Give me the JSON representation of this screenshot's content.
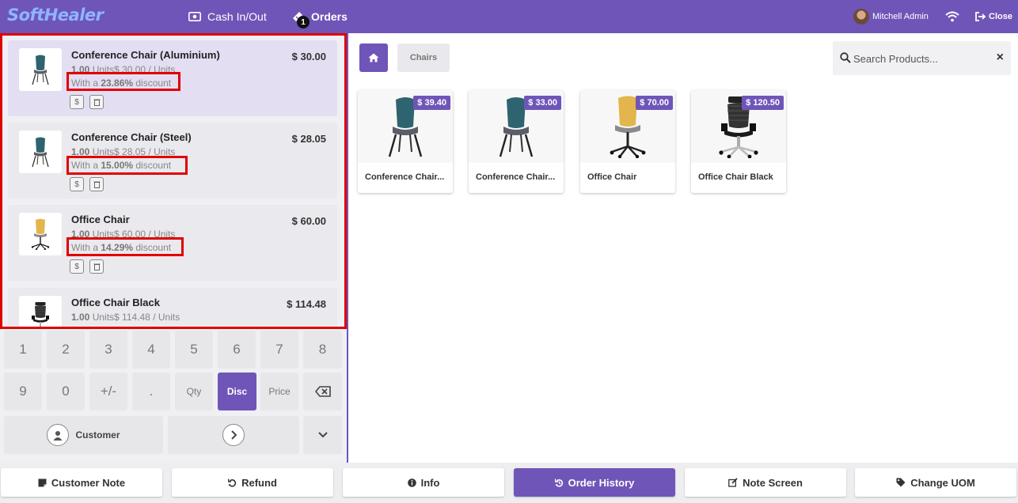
{
  "topbar": {
    "logo": "SoftHealer",
    "cash_label": "Cash In/Out",
    "orders_label": "Orders",
    "orders_badge": "1",
    "user_name": "Mitchell Admin",
    "close_label": "Close"
  },
  "orderlines": [
    {
      "name": "Conference Chair (Aluminium)",
      "price": "$ 30.00",
      "qty": "1.00",
      "unit_info": " Units$ 30.00 / Units",
      "disc_prefix": "With a ",
      "disc_value": "23.86%",
      "disc_suffix": " discount",
      "icon": "teal-chair-icon",
      "selected": true
    },
    {
      "name": "Conference Chair (Steel)",
      "price": "$ 28.05",
      "qty": "1.00",
      "unit_info": " Units$ 28.05 / Units",
      "disc_prefix": "With a ",
      "disc_value": "15.00%",
      "disc_suffix": " discount",
      "icon": "teal-chair-icon",
      "selected": false
    },
    {
      "name": "Office Chair",
      "price": "$ 60.00",
      "qty": "1.00",
      "unit_info": " Units$ 60.00 / Units",
      "disc_prefix": "With a ",
      "disc_value": "14.29%",
      "disc_suffix": " discount",
      "icon": "yellow-chair-icon",
      "selected": false
    },
    {
      "name": "Office Chair Black",
      "price": "$ 114.48",
      "qty": "1.00",
      "unit_info": " Units$ 114.48 / Units",
      "icon": "black-office-chair-icon",
      "selected": false
    }
  ],
  "numpad": {
    "row1": [
      "1",
      "2",
      "3",
      "4",
      "5",
      "6",
      "7",
      "8"
    ],
    "row2": [
      "9",
      "0",
      "+/-",
      "."
    ],
    "qty": "Qty",
    "disc": "Disc",
    "price": "Price",
    "customer": "Customer"
  },
  "products_screen": {
    "category": "Chairs",
    "search_placeholder": "Search Products...",
    "products": [
      {
        "name": "Conference Chair...",
        "price": "$ 39.40",
        "icon": "teal-chair-icon"
      },
      {
        "name": "Conference Chair...",
        "price": "$ 33.00",
        "icon": "teal-chair-icon"
      },
      {
        "name": "Office Chair",
        "price": "$ 70.00",
        "icon": "yellow-chair-icon"
      },
      {
        "name": "Office Chair Black",
        "price": "$ 120.50",
        "icon": "black-office-chair-icon"
      }
    ]
  },
  "bottom_bar": {
    "customer_note": "Customer Note",
    "refund": "Refund",
    "info": "Info",
    "order_history": "Order History",
    "note_screen": "Note Screen",
    "change_uom": "Change UOM"
  },
  "colors": {
    "primary": "#6f55b8",
    "highlight": "#e00000",
    "selected_line": "#e4def2"
  }
}
